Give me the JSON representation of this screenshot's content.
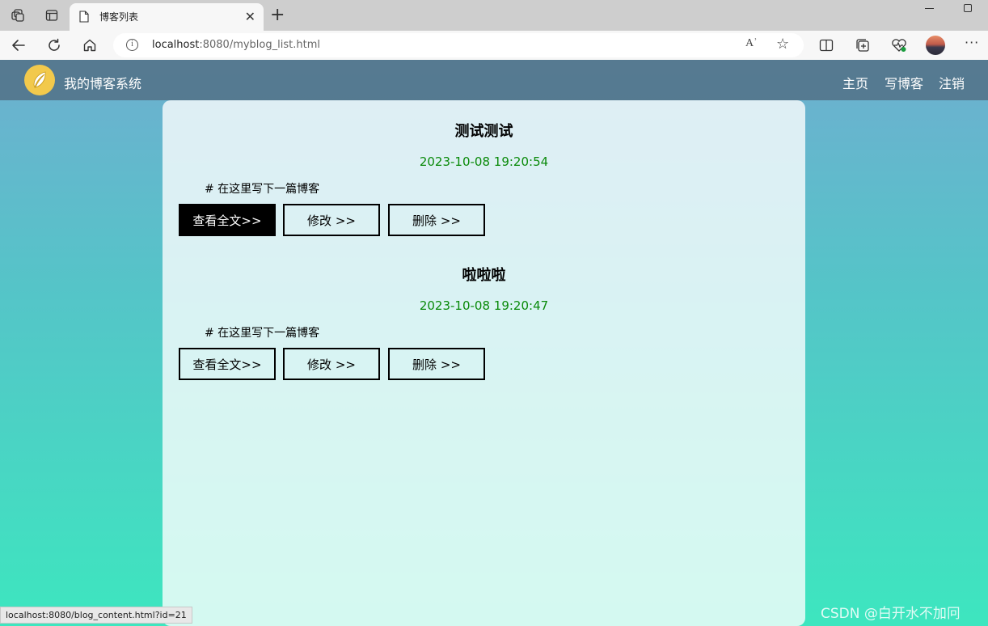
{
  "browser": {
    "tab_title": "博客列表",
    "url_host": "localhost",
    "url_rest": ":8080/myblog_list.html",
    "read_aloud_label": "Aʾ",
    "status_link": "localhost:8080/blog_content.html?id=21"
  },
  "site": {
    "title": "我的博客系统",
    "nav": [
      "主页",
      "写博客",
      "注销"
    ]
  },
  "blogs": [
    {
      "title": "测试测试",
      "date": "2023-10-08 19:20:54",
      "desc": "# 在这里写下一篇博客",
      "buttons": [
        "查看全文>>",
        "修改 >>",
        "删除 >>"
      ]
    },
    {
      "title": "啦啦啦",
      "date": "2023-10-08 19:20:47",
      "desc": "# 在这里写下一篇博客",
      "buttons": [
        "查看全文>>",
        "修改 >>",
        "删除 >>"
      ]
    }
  ],
  "watermark": "CSDN @白开水不加冋",
  "colors": {
    "nav_bg": "#5b8096",
    "date_green": "#0a8a0a",
    "gradient_top": "#6eafd0",
    "gradient_bottom": "#3de6bf"
  },
  "icons": [
    "workspaces-icon",
    "tab-actions-icon",
    "page-icon",
    "back-icon",
    "refresh-icon",
    "home-icon",
    "info-icon",
    "read-aloud-icon",
    "favorite-star-icon",
    "split-screen-icon",
    "collections-icon",
    "performance-icon",
    "profile-avatar",
    "more-icon",
    "feather-logo-icon"
  ]
}
